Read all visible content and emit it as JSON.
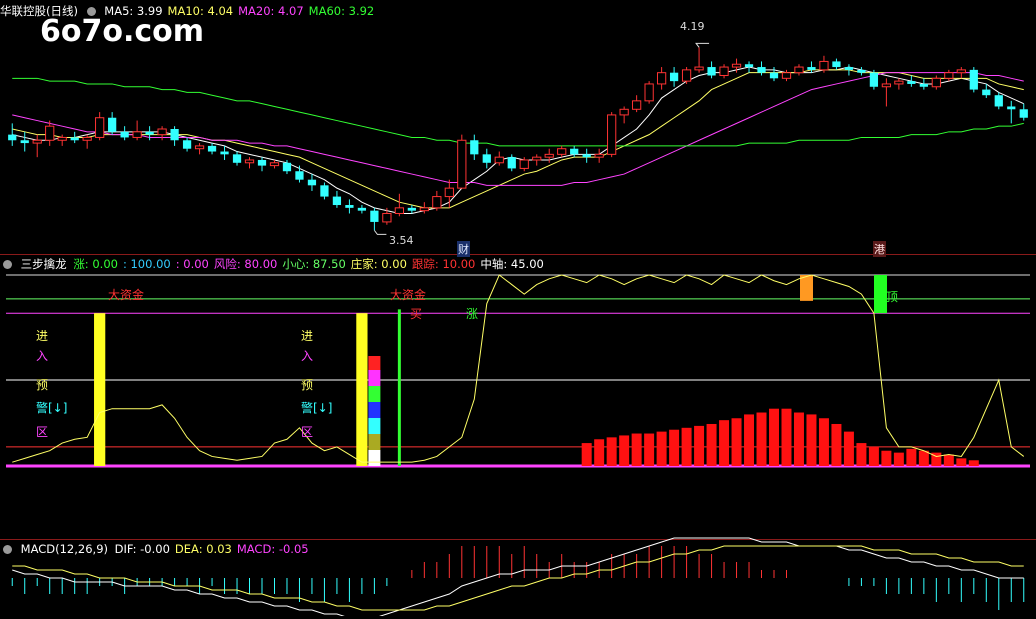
{
  "watermark": "6o7o.com",
  "panel_main": {
    "title": "华联控股(日线)",
    "ma": [
      {
        "label": "MA5: 3.99",
        "color": "#ffffff"
      },
      {
        "label": "MA10: 4.04",
        "color": "#ffff66"
      },
      {
        "label": "MA20: 4.07",
        "color": "#ff44ff"
      },
      {
        "label": "MA60: 3.92",
        "color": "#33ff33"
      }
    ],
    "high_label": "4.19",
    "low_label": "3.54",
    "markers": [
      {
        "text": "财",
        "color": "#6fb6ff"
      },
      {
        "text": "港",
        "color": "#ff6b6b"
      }
    ]
  },
  "panel_ind": {
    "title": "三步擒龙",
    "items": [
      {
        "label": "涨: 0.00",
        "color": "#33ff33"
      },
      {
        "label": ": 100.00",
        "color": "#33ccff"
      },
      {
        "label": ": 0.00",
        "color": "#ff44ff"
      },
      {
        "label": "风险: 80.00",
        "color": "#ff44ff"
      },
      {
        "label": "小心: 87.50",
        "color": "#66ff66"
      },
      {
        "label": "庄家: 0.00",
        "color": "#ffff66"
      },
      {
        "label": "跟踪: 10.00",
        "color": "#ff3333"
      },
      {
        "label": "中轴: 45.00",
        "color": "#ffffff"
      }
    ],
    "labels": {
      "big_money": "大资金",
      "buy": "买",
      "rise": "涨",
      "top": "顶",
      "zone_chars": [
        "进",
        "入",
        "预",
        "警[↓]",
        "区"
      ]
    }
  },
  "panel_macd": {
    "title": "MACD(12,26,9)",
    "items": [
      {
        "label": "DIF: -0.00",
        "color": "#ffffff"
      },
      {
        "label": "DEA: 0.03",
        "color": "#ffff66"
      },
      {
        "label": "MACD: -0.05",
        "color": "#ff44ff"
      }
    ]
  },
  "chart_data": {
    "type": "candlestick",
    "candles": [
      [
        3.88,
        3.92,
        3.84,
        3.86
      ],
      [
        3.86,
        3.89,
        3.82,
        3.85
      ],
      [
        3.85,
        3.88,
        3.8,
        3.86
      ],
      [
        3.86,
        3.93,
        3.84,
        3.91
      ],
      [
        3.86,
        3.88,
        3.84,
        3.87
      ],
      [
        3.87,
        3.89,
        3.85,
        3.86
      ],
      [
        3.86,
        3.88,
        3.83,
        3.87
      ],
      [
        3.87,
        3.96,
        3.86,
        3.94
      ],
      [
        3.94,
        3.96,
        3.88,
        3.89
      ],
      [
        3.89,
        3.91,
        3.86,
        3.87
      ],
      [
        3.87,
        3.93,
        3.86,
        3.89
      ],
      [
        3.89,
        3.91,
        3.86,
        3.88
      ],
      [
        3.88,
        3.91,
        3.86,
        3.9
      ],
      [
        3.9,
        3.91,
        3.84,
        3.86
      ],
      [
        3.86,
        3.87,
        3.82,
        3.83
      ],
      [
        3.83,
        3.85,
        3.81,
        3.84
      ],
      [
        3.84,
        3.85,
        3.81,
        3.82
      ],
      [
        3.82,
        3.84,
        3.79,
        3.81
      ],
      [
        3.81,
        3.82,
        3.77,
        3.78
      ],
      [
        3.78,
        3.8,
        3.76,
        3.79
      ],
      [
        3.79,
        3.8,
        3.75,
        3.77
      ],
      [
        3.77,
        3.79,
        3.76,
        3.78
      ],
      [
        3.78,
        3.79,
        3.74,
        3.75
      ],
      [
        3.75,
        3.77,
        3.71,
        3.72
      ],
      [
        3.72,
        3.74,
        3.68,
        3.7
      ],
      [
        3.7,
        3.71,
        3.65,
        3.66
      ],
      [
        3.66,
        3.68,
        3.62,
        3.63
      ],
      [
        3.63,
        3.65,
        3.6,
        3.62
      ],
      [
        3.62,
        3.63,
        3.6,
        3.61
      ],
      [
        3.61,
        3.62,
        3.54,
        3.57
      ],
      [
        3.57,
        3.62,
        3.56,
        3.6
      ],
      [
        3.6,
        3.67,
        3.59,
        3.62
      ],
      [
        3.62,
        3.63,
        3.6,
        3.61
      ],
      [
        3.61,
        3.64,
        3.6,
        3.62
      ],
      [
        3.62,
        3.68,
        3.61,
        3.66
      ],
      [
        3.66,
        3.72,
        3.62,
        3.69
      ],
      [
        3.69,
        3.88,
        3.69,
        3.86
      ],
      [
        3.86,
        3.88,
        3.79,
        3.81
      ],
      [
        3.81,
        3.83,
        3.76,
        3.78
      ],
      [
        3.78,
        3.82,
        3.77,
        3.8
      ],
      [
        3.8,
        3.81,
        3.75,
        3.76
      ],
      [
        3.76,
        3.8,
        3.75,
        3.79
      ],
      [
        3.79,
        3.81,
        3.77,
        3.8
      ],
      [
        3.8,
        3.83,
        3.78,
        3.81
      ],
      [
        3.81,
        3.84,
        3.8,
        3.83
      ],
      [
        3.83,
        3.84,
        3.8,
        3.81
      ],
      [
        3.81,
        3.83,
        3.78,
        3.8
      ],
      [
        3.8,
        3.83,
        3.78,
        3.81
      ],
      [
        3.81,
        3.96,
        3.8,
        3.95
      ],
      [
        3.95,
        3.98,
        3.92,
        3.97
      ],
      [
        3.97,
        4.02,
        3.96,
        4.0
      ],
      [
        4.0,
        4.07,
        3.99,
        4.06
      ],
      [
        4.06,
        4.12,
        4.04,
        4.1
      ],
      [
        4.1,
        4.12,
        4.05,
        4.07
      ],
      [
        4.07,
        4.12,
        4.06,
        4.11
      ],
      [
        4.11,
        4.19,
        4.1,
        4.12
      ],
      [
        4.12,
        4.14,
        4.08,
        4.09
      ],
      [
        4.09,
        4.13,
        4.08,
        4.12
      ],
      [
        4.12,
        4.15,
        4.1,
        4.13
      ],
      [
        4.13,
        4.14,
        4.1,
        4.12
      ],
      [
        4.12,
        4.14,
        4.09,
        4.1
      ],
      [
        4.1,
        4.12,
        4.07,
        4.08
      ],
      [
        4.08,
        4.11,
        4.07,
        4.1
      ],
      [
        4.1,
        4.13,
        4.09,
        4.12
      ],
      [
        4.12,
        4.14,
        4.1,
        4.11
      ],
      [
        4.11,
        4.16,
        4.1,
        4.14
      ],
      [
        4.14,
        4.15,
        4.11,
        4.12
      ],
      [
        4.12,
        4.13,
        4.09,
        4.11
      ],
      [
        4.11,
        4.12,
        4.09,
        4.1
      ],
      [
        4.1,
        4.11,
        4.04,
        4.05
      ],
      [
        4.05,
        4.08,
        3.98,
        4.06
      ],
      [
        4.06,
        4.08,
        4.04,
        4.07
      ],
      [
        4.07,
        4.09,
        4.05,
        4.06
      ],
      [
        4.06,
        4.08,
        4.04,
        4.05
      ],
      [
        4.05,
        4.09,
        4.04,
        4.08
      ],
      [
        4.08,
        4.11,
        4.07,
        4.1
      ],
      [
        4.1,
        4.12,
        4.08,
        4.11
      ],
      [
        4.11,
        4.12,
        4.03,
        4.04
      ],
      [
        4.04,
        4.06,
        4.01,
        4.02
      ],
      [
        4.02,
        4.03,
        3.97,
        3.98
      ],
      [
        3.98,
        4.0,
        3.92,
        3.97
      ],
      [
        3.97,
        3.99,
        3.93,
        3.94
      ]
    ],
    "ma_series": {
      "MA5": [
        3.88,
        3.87,
        3.86,
        3.86,
        3.87,
        3.87,
        3.88,
        3.89,
        3.89,
        3.89,
        3.89,
        3.89,
        3.89,
        3.88,
        3.87,
        3.86,
        3.85,
        3.84,
        3.82,
        3.81,
        3.8,
        3.79,
        3.78,
        3.76,
        3.74,
        3.72,
        3.69,
        3.67,
        3.64,
        3.62,
        3.61,
        3.6,
        3.6,
        3.61,
        3.62,
        3.64,
        3.69,
        3.72,
        3.75,
        3.79,
        3.8,
        3.79,
        3.79,
        3.79,
        3.8,
        3.81,
        3.81,
        3.81,
        3.84,
        3.87,
        3.9,
        3.95,
        4.01,
        4.04,
        4.07,
        4.09,
        4.1,
        4.1,
        4.11,
        4.12,
        4.11,
        4.11,
        4.1,
        4.1,
        4.1,
        4.11,
        4.11,
        4.12,
        4.11,
        4.1,
        4.09,
        4.08,
        4.07,
        4.06,
        4.06,
        4.07,
        4.08,
        4.07,
        4.06,
        4.03,
        4.01,
        3.99
      ],
      "MA10": [
        3.9,
        3.89,
        3.88,
        3.88,
        3.87,
        3.87,
        3.87,
        3.88,
        3.88,
        3.88,
        3.88,
        3.88,
        3.88,
        3.88,
        3.88,
        3.87,
        3.86,
        3.86,
        3.85,
        3.84,
        3.83,
        3.82,
        3.81,
        3.8,
        3.78,
        3.76,
        3.74,
        3.72,
        3.7,
        3.68,
        3.66,
        3.64,
        3.63,
        3.62,
        3.62,
        3.62,
        3.64,
        3.66,
        3.68,
        3.7,
        3.72,
        3.74,
        3.75,
        3.77,
        3.79,
        3.8,
        3.8,
        3.8,
        3.82,
        3.84,
        3.86,
        3.88,
        3.91,
        3.94,
        3.97,
        4.0,
        4.04,
        4.06,
        4.08,
        4.1,
        4.1,
        4.1,
        4.1,
        4.1,
        4.11,
        4.11,
        4.11,
        4.11,
        4.1,
        4.1,
        4.1,
        4.1,
        4.09,
        4.08,
        4.08,
        4.08,
        4.08,
        4.08,
        4.08,
        4.06,
        4.05,
        4.04
      ],
      "MA20": [
        3.95,
        3.94,
        3.93,
        3.92,
        3.91,
        3.9,
        3.89,
        3.89,
        3.88,
        3.88,
        3.88,
        3.87,
        3.87,
        3.87,
        3.87,
        3.87,
        3.86,
        3.86,
        3.86,
        3.85,
        3.85,
        3.84,
        3.84,
        3.83,
        3.82,
        3.81,
        3.8,
        3.79,
        3.78,
        3.77,
        3.76,
        3.75,
        3.74,
        3.73,
        3.72,
        3.71,
        3.71,
        3.71,
        3.7,
        3.7,
        3.7,
        3.7,
        3.7,
        3.7,
        3.7,
        3.71,
        3.71,
        3.72,
        3.73,
        3.74,
        3.76,
        3.78,
        3.8,
        3.82,
        3.84,
        3.86,
        3.88,
        3.9,
        3.92,
        3.94,
        3.96,
        3.98,
        4.0,
        4.02,
        4.04,
        4.05,
        4.06,
        4.07,
        4.08,
        4.09,
        4.1,
        4.1,
        4.1,
        4.1,
        4.1,
        4.1,
        4.1,
        4.1,
        4.09,
        4.09,
        4.08,
        4.07
      ],
      "MA60": [
        4.08,
        4.08,
        4.08,
        4.07,
        4.07,
        4.07,
        4.06,
        4.06,
        4.06,
        4.05,
        4.05,
        4.05,
        4.04,
        4.04,
        4.03,
        4.03,
        4.02,
        4.01,
        4.0,
        4.0,
        3.99,
        3.98,
        3.97,
        3.96,
        3.95,
        3.94,
        3.93,
        3.92,
        3.91,
        3.9,
        3.89,
        3.88,
        3.87,
        3.87,
        3.86,
        3.86,
        3.85,
        3.85,
        3.85,
        3.84,
        3.84,
        3.84,
        3.84,
        3.84,
        3.84,
        3.84,
        3.84,
        3.84,
        3.84,
        3.84,
        3.84,
        3.84,
        3.84,
        3.84,
        3.84,
        3.84,
        3.84,
        3.84,
        3.84,
        3.85,
        3.85,
        3.85,
        3.85,
        3.86,
        3.86,
        3.86,
        3.86,
        3.86,
        3.87,
        3.87,
        3.87,
        3.87,
        3.88,
        3.88,
        3.88,
        3.89,
        3.89,
        3.9,
        3.9,
        3.91,
        3.91,
        3.92
      ]
    },
    "price_range": [
      3.52,
      4.28
    ],
    "indicator": {
      "range": [
        0,
        100
      ],
      "h_lines": [
        {
          "value": 100,
          "color": "#dddddd"
        },
        {
          "value": 87.5,
          "color": "#66ff66"
        },
        {
          "value": 80,
          "color": "#ff44ff"
        },
        {
          "value": 45,
          "color": "#ffffff"
        },
        {
          "value": 10,
          "color": "#ff3333"
        },
        {
          "value": 0,
          "color": "#ff44ff"
        }
      ],
      "curve": [
        2,
        4,
        6,
        8,
        12,
        14,
        15,
        28,
        30,
        30,
        30,
        30,
        32,
        25,
        15,
        8,
        5,
        4,
        3,
        4,
        5,
        12,
        14,
        20,
        12,
        8,
        10,
        6,
        2,
        2,
        2,
        2,
        2,
        3,
        5,
        10,
        15,
        35,
        85,
        100,
        95,
        90,
        95,
        98,
        100,
        98,
        96,
        100,
        98,
        95,
        98,
        100,
        98,
        96,
        100,
        98,
        95,
        100,
        98,
        96,
        100,
        97,
        95,
        98,
        100,
        98,
        96,
        94,
        90,
        80,
        20,
        10,
        10,
        8,
        5,
        6,
        5,
        15,
        30,
        45,
        10,
        5,
        3,
        2,
        1
      ],
      "zone_bars": [
        {
          "index": 7,
          "value": 100,
          "color": "#ffff22"
        },
        {
          "index": 28,
          "value": 100,
          "color": "#ffff22"
        }
      ],
      "red_bars": [
        0,
        0,
        0,
        0,
        0,
        0,
        0,
        0,
        0,
        0,
        0,
        0,
        0,
        0,
        0,
        0,
        0,
        0,
        0,
        0,
        0,
        0,
        0,
        0,
        0,
        0,
        0,
        0,
        0,
        0,
        0,
        0,
        0,
        0,
        0,
        0,
        0,
        0,
        0,
        0,
        0,
        0,
        0,
        0,
        0,
        0,
        12,
        14,
        15,
        16,
        17,
        17,
        18,
        19,
        20,
        21,
        22,
        24,
        25,
        27,
        28,
        30,
        30,
        28,
        27,
        25,
        22,
        18,
        12,
        10,
        8,
        7,
        9,
        8,
        7,
        6,
        4,
        3
      ],
      "rise_line_index": 31
    },
    "macd": {
      "dif": [
        0.02,
        0.01,
        0.01,
        0.0,
        0.0,
        -0.01,
        -0.01,
        -0.01,
        -0.01,
        -0.02,
        -0.02,
        -0.02,
        -0.02,
        -0.03,
        -0.03,
        -0.04,
        -0.04,
        -0.05,
        -0.05,
        -0.06,
        -0.06,
        -0.07,
        -0.07,
        -0.08,
        -0.08,
        -0.09,
        -0.09,
        -0.1,
        -0.1,
        -0.1,
        -0.09,
        -0.08,
        -0.07,
        -0.06,
        -0.05,
        -0.04,
        -0.02,
        -0.01,
        0.0,
        0.01,
        0.01,
        0.02,
        0.02,
        0.02,
        0.03,
        0.03,
        0.03,
        0.04,
        0.05,
        0.06,
        0.07,
        0.08,
        0.09,
        0.1,
        0.1,
        0.1,
        0.1,
        0.1,
        0.1,
        0.1,
        0.09,
        0.09,
        0.09,
        0.08,
        0.08,
        0.08,
        0.08,
        0.07,
        0.07,
        0.06,
        0.05,
        0.05,
        0.04,
        0.04,
        0.03,
        0.03,
        0.02,
        0.02,
        0.01,
        0.0,
        0.0,
        0.0
      ],
      "dea": [
        0.03,
        0.03,
        0.02,
        0.02,
        0.02,
        0.01,
        0.01,
        0.0,
        0.0,
        0.0,
        -0.01,
        -0.01,
        -0.01,
        -0.02,
        -0.02,
        -0.02,
        -0.03,
        -0.03,
        -0.03,
        -0.04,
        -0.04,
        -0.05,
        -0.05,
        -0.05,
        -0.06,
        -0.06,
        -0.07,
        -0.07,
        -0.08,
        -0.08,
        -0.08,
        -0.08,
        -0.08,
        -0.08,
        -0.07,
        -0.07,
        -0.06,
        -0.05,
        -0.04,
        -0.03,
        -0.02,
        -0.02,
        -0.01,
        0.0,
        0.0,
        0.01,
        0.01,
        0.02,
        0.02,
        0.03,
        0.04,
        0.04,
        0.05,
        0.06,
        0.06,
        0.07,
        0.07,
        0.08,
        0.08,
        0.08,
        0.08,
        0.08,
        0.08,
        0.08,
        0.08,
        0.08,
        0.08,
        0.08,
        0.08,
        0.07,
        0.07,
        0.07,
        0.06,
        0.06,
        0.06,
        0.05,
        0.05,
        0.04,
        0.04,
        0.04,
        0.03,
        0.03
      ]
    }
  }
}
